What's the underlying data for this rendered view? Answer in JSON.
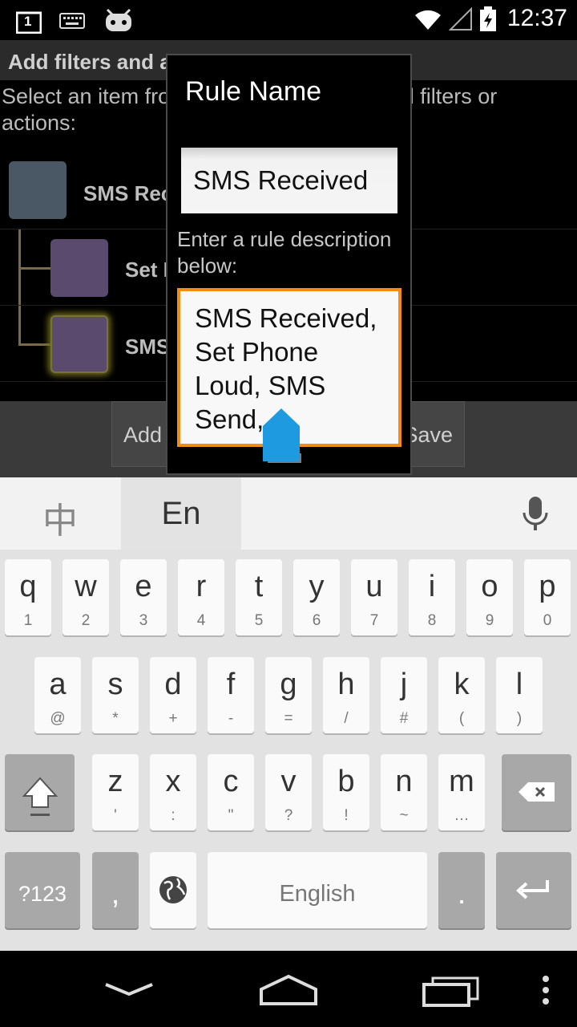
{
  "status_bar": {
    "time": "12:37",
    "notification_badge": "1",
    "icons": [
      "notification-icon",
      "keyboard-icon",
      "cyanogen-icon",
      "wifi-icon",
      "signal-icon",
      "battery-charging-icon"
    ]
  },
  "background_app": {
    "title": "Add filters and actions to your rule",
    "subtitle": "Select an item from the list below, then add filters or actions:",
    "tree": [
      {
        "label": "SMS Received"
      },
      {
        "label": "Set Phone Loud"
      },
      {
        "label": "SMS Send"
      }
    ],
    "buttons": {
      "add": "Add",
      "save": "Save"
    }
  },
  "dialog": {
    "title": "Rule Name",
    "name_value": "SMS Received",
    "description_label": "Enter a rule description below:",
    "description_value": "SMS Received, Set Phone Loud, SMS Send,"
  },
  "keyboard": {
    "lang_chinese": "中",
    "lang_selected": "En",
    "row1": [
      {
        "k": "q",
        "s": "1"
      },
      {
        "k": "w",
        "s": "2"
      },
      {
        "k": "e",
        "s": "3"
      },
      {
        "k": "r",
        "s": "4"
      },
      {
        "k": "t",
        "s": "5"
      },
      {
        "k": "y",
        "s": "6"
      },
      {
        "k": "u",
        "s": "7"
      },
      {
        "k": "i",
        "s": "8"
      },
      {
        "k": "o",
        "s": "9"
      },
      {
        "k": "p",
        "s": "0"
      }
    ],
    "row2": [
      {
        "k": "a",
        "s": "@"
      },
      {
        "k": "s",
        "s": "*"
      },
      {
        "k": "d",
        "s": "+"
      },
      {
        "k": "f",
        "s": "-"
      },
      {
        "k": "g",
        "s": "="
      },
      {
        "k": "h",
        "s": "/"
      },
      {
        "k": "j",
        "s": "#"
      },
      {
        "k": "k",
        "s": "("
      },
      {
        "k": "l",
        "s": ")"
      }
    ],
    "row3": [
      {
        "k": "z",
        "s": "'"
      },
      {
        "k": "x",
        "s": ":"
      },
      {
        "k": "c",
        "s": "\""
      },
      {
        "k": "v",
        "s": "?"
      },
      {
        "k": "b",
        "s": "!"
      },
      {
        "k": "n",
        "s": "~"
      },
      {
        "k": "m",
        "s": "…"
      }
    ],
    "sym_key": "?123",
    "comma_key": ",",
    "space_label": "English",
    "period_key": "."
  },
  "colors": {
    "accent_orange": "#f28c14",
    "selection_blue": "#1e9be0",
    "filter_icon": "#4a5866",
    "action_icon": "#5a4a6e"
  }
}
